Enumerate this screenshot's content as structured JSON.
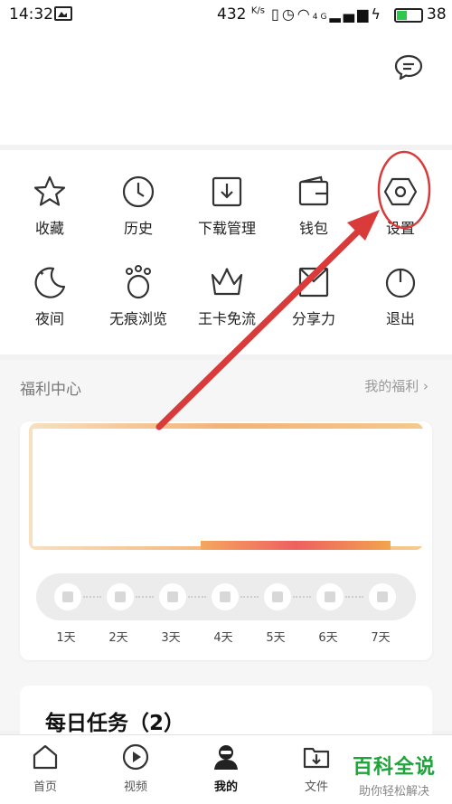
{
  "status_bar": {
    "time": "14:32",
    "speed": "432",
    "speed_unit": "K/s",
    "network": "4G",
    "battery": "38",
    "battery_color": "#2ec84a"
  },
  "header": {
    "message_icon": "chat-bubble-icon"
  },
  "grid": {
    "items": [
      {
        "label": "收藏",
        "icon": "star-icon"
      },
      {
        "label": "历史",
        "icon": "clock-icon"
      },
      {
        "label": "下载管理",
        "icon": "download-icon"
      },
      {
        "label": "钱包",
        "icon": "wallet-icon"
      },
      {
        "label": "设置",
        "icon": "settings-hexagon-icon"
      },
      {
        "label": "夜间",
        "icon": "moon-icon"
      },
      {
        "label": "无痕浏览",
        "icon": "paw-icon"
      },
      {
        "label": "王卡免流",
        "icon": "crown-icon"
      },
      {
        "label": "分享力",
        "icon": "share-envelope-icon"
      },
      {
        "label": "退出",
        "icon": "power-icon"
      }
    ]
  },
  "welfare": {
    "title": "福利中心",
    "link": "我的福利 ›"
  },
  "checkin": {
    "days": [
      "1天",
      "2天",
      "3天",
      "4天",
      "5天",
      "6天",
      "7天"
    ]
  },
  "daily_tasks": {
    "title": "每日任务（2）"
  },
  "bottom_nav": {
    "items": [
      {
        "label": "首页",
        "icon": "home-icon"
      },
      {
        "label": "视频",
        "icon": "play-icon"
      },
      {
        "label": "我的",
        "icon": "profile-icon",
        "active": true
      },
      {
        "label": "文件",
        "icon": "file-download-icon"
      }
    ]
  },
  "watermark": {
    "brand": "百科全说",
    "slogan": "助你轻松解决",
    "brand_color": "#1fa33b"
  },
  "annotation": {
    "highlight_color": "#d93a3a",
    "target": "设置"
  }
}
